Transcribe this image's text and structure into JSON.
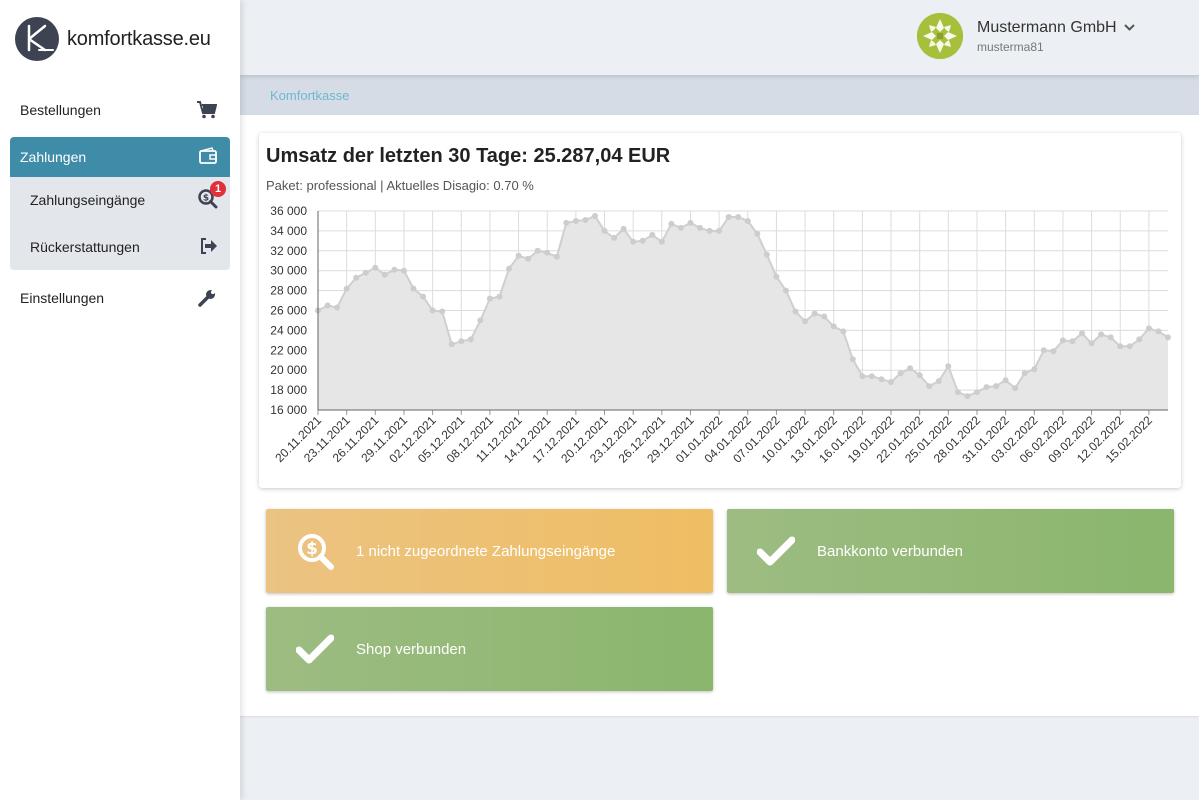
{
  "brand": {
    "name": "komfortkasse.eu"
  },
  "sidebar": {
    "items": [
      {
        "label": "Bestellungen",
        "icon": "cart-icon"
      },
      {
        "label": "Zahlungen",
        "icon": "wallet-icon"
      },
      {
        "label": "Zahlungseingänge",
        "icon": "payment-search-icon",
        "badge": "1"
      },
      {
        "label": "Rückerstattungen",
        "icon": "sign-out-icon"
      },
      {
        "label": "Einstellungen",
        "icon": "wrench-icon"
      }
    ]
  },
  "user": {
    "name": "Mustermann GmbH",
    "username": "musterma81"
  },
  "breadcrumb": {
    "label": "Komfortkasse"
  },
  "card": {
    "title": "Umsatz der letzten 30 Tage: 25.287,04 EUR",
    "subtitle": "Paket: professional | Aktuelles Disagio: 0.70 %"
  },
  "tiles": [
    {
      "label": "1 nicht zugeordnete Zahlungseingänge",
      "icon": "search-dollar-icon",
      "color": "#efbe63"
    },
    {
      "label": "Bankkonto verbunden",
      "icon": "check-icon",
      "color": "#8ab66d"
    },
    {
      "label": "Shop verbunden",
      "icon": "check-icon",
      "color": "#8ab66d"
    }
  ],
  "colors": {
    "accent": "#3e8ca8",
    "badge": "#e0303a"
  },
  "chart_data": {
    "type": "area",
    "title": "",
    "xlabel": "",
    "ylabel": "",
    "ylim": [
      16000,
      36000
    ],
    "yticks": [
      "16 000",
      "18 000",
      "20 000",
      "22 000",
      "24 000",
      "26 000",
      "28 000",
      "30 000",
      "32 000",
      "34 000",
      "36 000"
    ],
    "x_start": "20.11.2021",
    "x_tick_labels": [
      "20.11.2021",
      "23.11.2021",
      "26.11.2021",
      "29.11.2021",
      "02.12.2021",
      "05.12.2021",
      "08.12.2021",
      "11.12.2021",
      "14.12.2021",
      "17.12.2021",
      "20.12.2021",
      "23.12.2021",
      "26.12.2021",
      "29.12.2021",
      "01.01.2022",
      "04.01.2022",
      "07.01.2022",
      "10.01.2022",
      "13.01.2022",
      "16.01.2022",
      "19.01.2022",
      "22.01.2022",
      "25.01.2022",
      "28.01.2022",
      "31.01.2022",
      "03.02.2022",
      "06.02.2022",
      "09.02.2022",
      "12.02.2022",
      "15.02.2022"
    ],
    "grid": true,
    "series": [
      {
        "name": "",
        "values": [
          26000,
          26500,
          26300,
          28200,
          29300,
          29800,
          30300,
          29600,
          30100,
          30000,
          28200,
          27400,
          26000,
          25900,
          22600,
          22900,
          23100,
          25000,
          27200,
          27400,
          30200,
          31500,
          31200,
          32000,
          31800,
          31400,
          34800,
          35000,
          35100,
          35500,
          34000,
          33300,
          34200,
          32900,
          33000,
          33600,
          32900,
          34700,
          34300,
          34800,
          34300,
          34000,
          34000,
          35400,
          35400,
          35000,
          33700,
          31600,
          29400,
          28000,
          25900,
          24900,
          25700,
          25400,
          24400,
          23900,
          21100,
          19400,
          19400,
          19100,
          18800,
          19700,
          20200,
          19500,
          18400,
          18900,
          20400,
          17800,
          17400,
          17800,
          18300,
          18400,
          19000,
          18200,
          19700,
          20100,
          22000,
          21900,
          23000,
          22900,
          23700,
          22700,
          23600,
          23300,
          22400,
          22400,
          23100,
          24200,
          23900,
          23300
        ]
      }
    ]
  }
}
